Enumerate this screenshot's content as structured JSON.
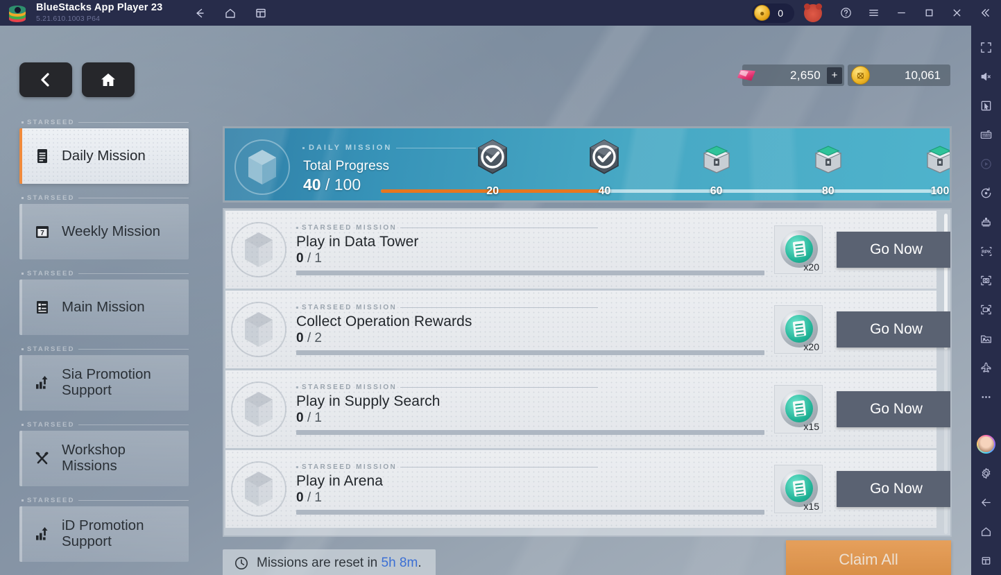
{
  "titlebar": {
    "app_name": "BlueStacks App Player 23",
    "version": "5.21.610.1003  P64",
    "nav_icons": [
      "back-arrow-icon",
      "home-icon",
      "multi-instance-icon"
    ],
    "coin_count": "0",
    "controls": [
      "help-icon",
      "menu-icon",
      "minimize-icon",
      "maximize-icon",
      "close-icon",
      "collapse-icon"
    ]
  },
  "game": {
    "nav": {
      "back_label": "‹",
      "home_label": "home"
    },
    "currency": {
      "gem_value": "2,650",
      "gem_plus": "+",
      "gold_value": "10,061"
    },
    "sidebar": {
      "group_label": "STARSEED",
      "items": [
        {
          "label": "Daily Mission",
          "icon": "list-document-icon",
          "active": true
        },
        {
          "label": "Weekly Mission",
          "icon": "calendar-7-icon",
          "active": false
        },
        {
          "label": "Main Mission",
          "icon": "checklist-icon",
          "active": false
        },
        {
          "label": "Sia Promotion\nSupport",
          "icon": "bar-chart-up-icon",
          "active": false
        },
        {
          "label": "Workshop\nMissions",
          "icon": "hammer-wrench-icon",
          "active": false
        },
        {
          "label": "iD Promotion\nSupport",
          "icon": "bar-chart-up-icon",
          "active": false
        }
      ]
    },
    "banner": {
      "kicker": "DAILY  MISSION",
      "title": "Total Progress",
      "current": "40",
      "separator": " / ",
      "total": "100",
      "progress_percent": 40,
      "milestones": [
        {
          "label": "20",
          "value": 20,
          "state": "checked"
        },
        {
          "label": "40",
          "value": 40,
          "state": "checked"
        },
        {
          "label": "60",
          "value": 60,
          "state": "locked"
        },
        {
          "label": "80",
          "value": 80,
          "state": "locked"
        },
        {
          "label": "100",
          "value": 100,
          "state": "locked"
        }
      ]
    },
    "missions": {
      "row_kicker": "STARSEED MISSION",
      "items": [
        {
          "title": "Play in Data Tower",
          "current": "0",
          "total": "1",
          "sep": " / ",
          "reward_qty": "x20",
          "action": "Go Now"
        },
        {
          "title": "Collect Operation Rewards",
          "current": "0",
          "total": "2",
          "sep": " / ",
          "reward_qty": "x20",
          "action": "Go Now"
        },
        {
          "title": "Play in Supply Search",
          "current": "0",
          "total": "1",
          "sep": " / ",
          "reward_qty": "x15",
          "action": "Go Now"
        },
        {
          "title": "Play in Arena",
          "current": "0",
          "total": "1",
          "sep": " / ",
          "reward_qty": "x15",
          "action": "Go Now"
        }
      ]
    },
    "footer": {
      "reset_prefix": "Missions are reset in ",
      "reset_time": "5h 8m",
      "reset_suffix": ".",
      "claim_label": "Claim All"
    }
  },
  "rail": {
    "icons": [
      "fullscreen-icon",
      "mute-icon",
      "pointer-icon",
      "keyboard-controls-icon",
      "play-macro-icon",
      "rotate-icon",
      "game-controls-icon",
      "rpk-icon",
      "screenshot-icon",
      "record-video-icon",
      "media-folder-icon",
      "boost-airplane-icon",
      "more-icon",
      "avatar-icon",
      "settings-gear-icon",
      "back-arrow-icon",
      "home-icon",
      "recents-icon"
    ],
    "rpk_label": "RPK"
  },
  "colors": {
    "accent_orange": "#f08a3c",
    "banner_blue": "#3793b8",
    "token_teal": "#22b598",
    "claim_orange": "#df8a37",
    "link_blue": "#3b6fd4",
    "chrome_navy": "#272c4a"
  }
}
